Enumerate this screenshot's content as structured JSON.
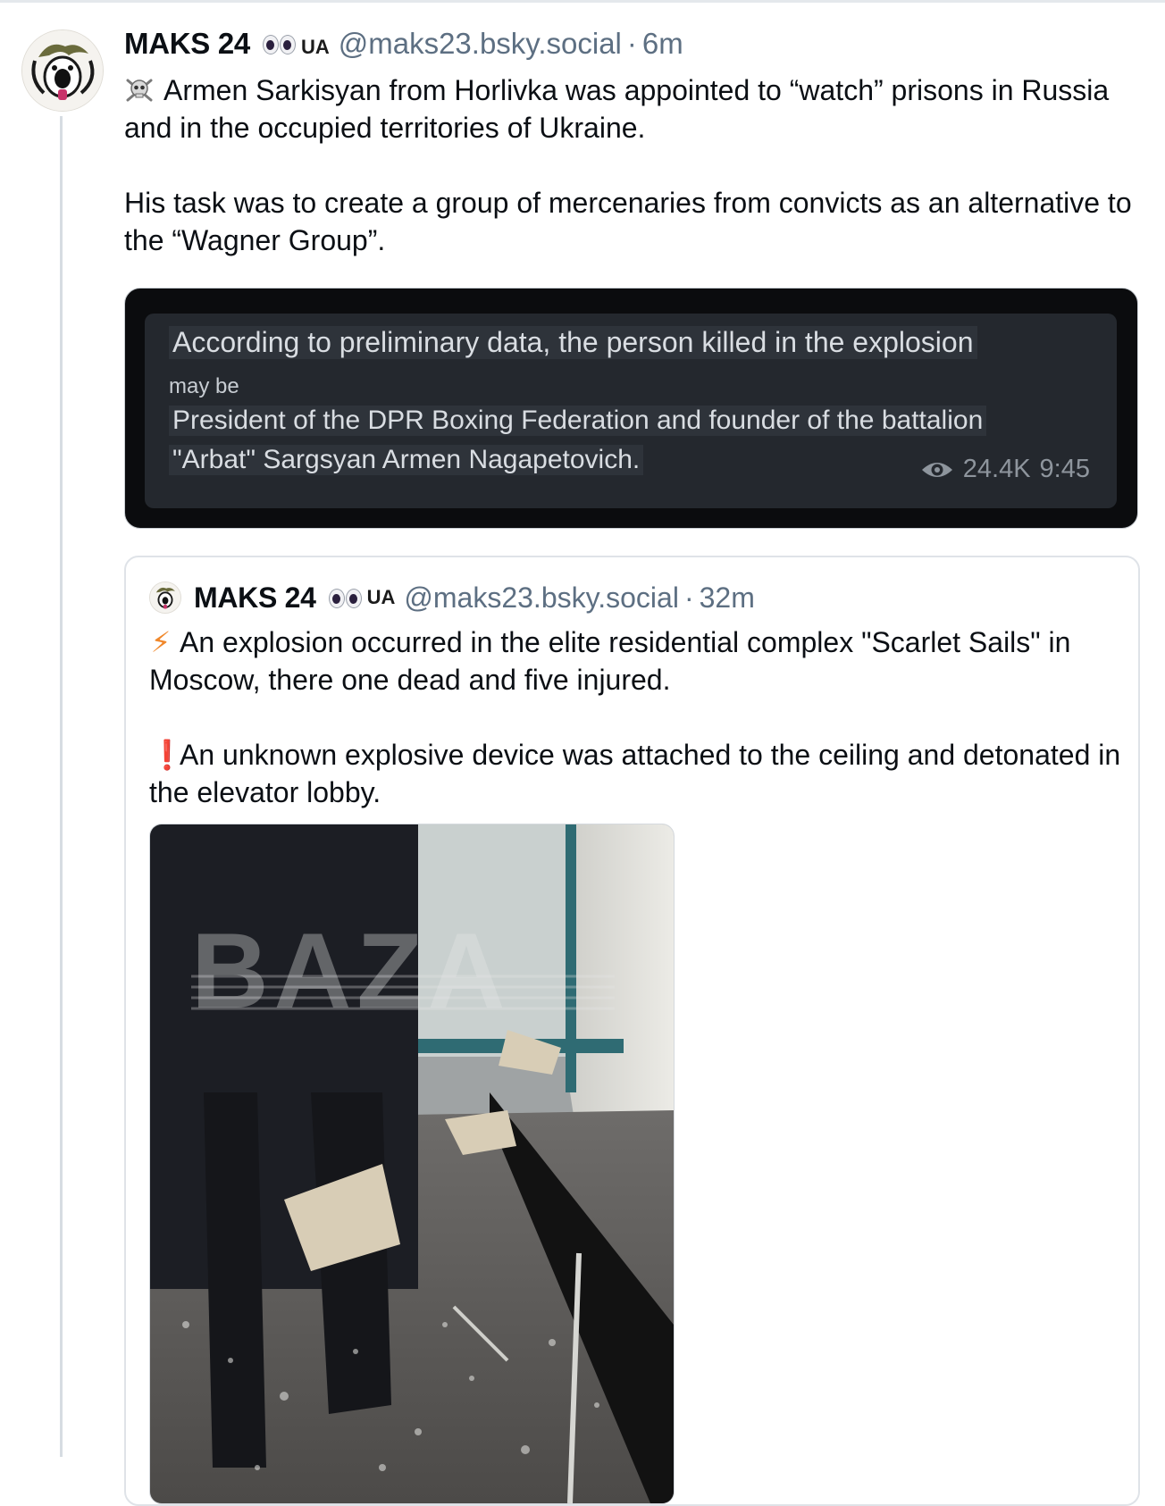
{
  "post": {
    "author_name": "MAKS 24",
    "flag_text": "UA",
    "handle": "@maks23.bsky.social",
    "separator": "·",
    "time": "6m",
    "paragraph1": "Armen Sarkisyan from Horlivka was appointed to “watch” prisons in Russia and in the occupied territories of Ukraine.",
    "paragraph2": "His task was to create a group of mercenaries from convicts as an alternative to the “Wagner Group”.",
    "paragraph1_icon": "skull-crossbones-icon"
  },
  "embedded_image": {
    "line1": "According to preliminary data, the person killed in the explosion",
    "line2": "may be",
    "line3": "President of the DPR Boxing Federation and founder of the battalion",
    "line4": "\"Arbat\" Sargsyan Armen Nagapetovich.",
    "views": "24.4K",
    "time": "9:45"
  },
  "quoted_post": {
    "author_name": "MAKS 24",
    "flag_text": "UA",
    "handle": "@maks23.bsky.social",
    "separator": "·",
    "time": "32m",
    "paragraph1": "An explosion occurred in the elite residential complex \"Scarlet Sails\" in Moscow, there one dead and five injured.",
    "paragraph1_icon": "lightning-bolt-icon",
    "paragraph2": "An unknown explosive device was attached to the ceiling and detonated in the elevator lobby.",
    "paragraph2_icon": "exclamation-icon",
    "bolt_glyph": "⚡",
    "bang_glyph": "❗",
    "image_watermark": "BAZA"
  },
  "colors": {
    "handle": "#5d6f82",
    "thread_line": "#d6dce2",
    "bolt": "#f0872a",
    "bang": "#e0293a"
  }
}
